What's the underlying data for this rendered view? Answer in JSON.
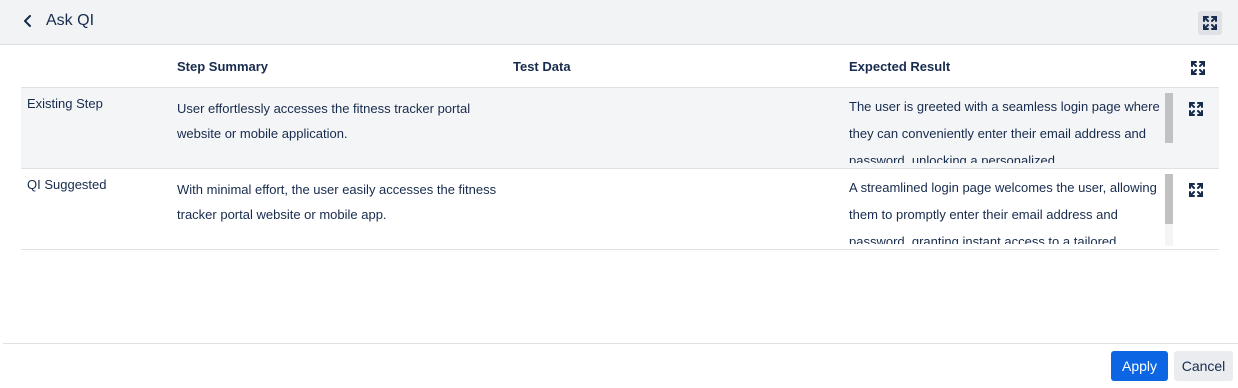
{
  "header": {
    "title": "Ask QI",
    "back_icon": "chevron-left-icon",
    "expand_icon": "expand-icon"
  },
  "table": {
    "columns": [
      "Step Summary",
      "Test Data",
      "Expected Result"
    ],
    "rows": [
      {
        "label": "Existing Step",
        "step_summary": "User effortlessly accesses the fitness tracker portal website or mobile application.",
        "test_data": "",
        "expected_result": "The user is greeted with a seamless login page where they can conveniently enter their email address and password, unlocking a personalized"
      },
      {
        "label": "QI Suggested",
        "step_summary": "With minimal effort, the user easily accesses the fitness tracker portal website or mobile app.",
        "test_data": "",
        "expected_result": "A streamlined login page welcomes the user, allowing them to promptly enter their email address and password, granting instant access to a tailored"
      }
    ]
  },
  "footer": {
    "apply_label": "Apply",
    "cancel_label": "Cancel"
  },
  "colors": {
    "accent": "#0c66e4",
    "header_bg": "#f2f3f5",
    "existing_row_bg": "#f4f5f7"
  }
}
